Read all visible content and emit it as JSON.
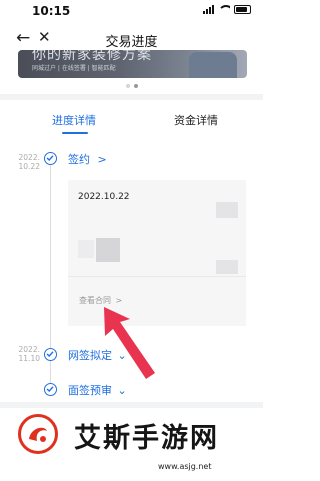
{
  "status_bar": {
    "time": "10:15"
  },
  "nav": {
    "title": "交易进度",
    "back_icon": "back-arrow-icon",
    "close_icon": "close-icon"
  },
  "banner": {
    "title": "你的新家装修方案",
    "subtitle": "同城过户 | 在线签署 | 智能匹配"
  },
  "tabs": [
    {
      "label": "进度详情",
      "active": true
    },
    {
      "label": "资金详情",
      "active": false
    }
  ],
  "steps": [
    {
      "date_line1": "2022.",
      "date_line2": "10.22",
      "label": "签约",
      "suffix": ">"
    },
    {
      "date_line1": "2022.",
      "date_line2": "11.10",
      "label": "网签拟定",
      "suffix": "⌄"
    },
    {
      "date_line1": "",
      "date_line2": "",
      "label": "面签预审",
      "suffix": "⌄"
    }
  ],
  "contract_card": {
    "date": "2022.10.22",
    "link_label": "查看合同",
    "link_suffix": ">"
  },
  "watermark": {
    "title": "艾斯手游网",
    "url": "www.asjg.net"
  },
  "colors": {
    "accent": "#1f6fe0",
    "arrow": "#e8344e",
    "watermark_red": "#e0301e"
  }
}
